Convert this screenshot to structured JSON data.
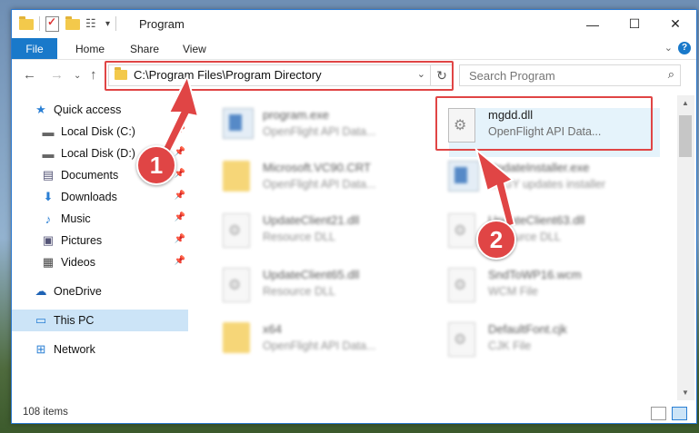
{
  "window": {
    "title": "Program",
    "minimize": "—",
    "maximize": "☐",
    "close": "✕"
  },
  "ribbon": {
    "file": "File",
    "home": "Home",
    "share": "Share",
    "view": "View",
    "expand": "⌄",
    "help": "?"
  },
  "nav": {
    "back": "←",
    "forward": "→",
    "recent": "⌄",
    "up": "↑"
  },
  "address": {
    "path": "C:\\Program Files\\Program Directory",
    "dropdown": "⌄",
    "refresh": "↻"
  },
  "search": {
    "placeholder": "Search Program",
    "icon": "⌕"
  },
  "sidebar": {
    "items": [
      {
        "label": "Quick access",
        "icon": "★",
        "pinned": false
      },
      {
        "label": "Local Disk (C:)",
        "icon": "▬",
        "pinned": true
      },
      {
        "label": "Local Disk (D:)",
        "icon": "▬",
        "pinned": true
      },
      {
        "label": "Documents",
        "icon": "▤",
        "pinned": true
      },
      {
        "label": "Downloads",
        "icon": "⬇",
        "pinned": true
      },
      {
        "label": "Music",
        "icon": "♪",
        "pinned": true
      },
      {
        "label": "Pictures",
        "icon": "▣",
        "pinned": true
      },
      {
        "label": "Videos",
        "icon": "▦",
        "pinned": true
      },
      {
        "label": "OneDrive",
        "icon": "☁",
        "pinned": false
      },
      {
        "label": "This PC",
        "icon": "▭",
        "pinned": false,
        "selected": true
      },
      {
        "label": "Network",
        "icon": "⊞",
        "pinned": false
      }
    ],
    "pin_glyph": "📌"
  },
  "files": [
    {
      "name": "program.exe",
      "desc": "OpenFlight API Data...",
      "icon": "exe-icon"
    },
    {
      "name": "mgdd.dll",
      "desc": "OpenFlight API Data...",
      "icon": "dll-gear-icon",
      "highlighted": true
    },
    {
      "name": "Microsoft.VC90.CRT",
      "desc": "OpenFlight API Data...",
      "icon": "folder-icon"
    },
    {
      "name": "UpdateInstaller.exe",
      "desc": "SAGY updates installer",
      "icon": "installer-icon"
    },
    {
      "name": "UpdateClient21.dll",
      "desc": "Resource DLL",
      "icon": "dll-gear-icon"
    },
    {
      "name": "UpdateClient63.dll",
      "desc": "Resource DLL",
      "icon": "dll-gear-icon"
    },
    {
      "name": "UpdateClient65.dll",
      "desc": "Resource DLL",
      "icon": "dll-gear-icon"
    },
    {
      "name": "SndToWP16.wcm",
      "desc": "WCM File",
      "icon": "file-icon"
    },
    {
      "name": "x64",
      "desc": "OpenFlight API Data...",
      "icon": "folder-icon"
    },
    {
      "name": "DefaultFont.cjk",
      "desc": "CJK File",
      "icon": "file-icon"
    }
  ],
  "status": {
    "count": "108 items"
  },
  "annotations": {
    "step1": "1",
    "step2": "2",
    "color": "#e04545"
  }
}
